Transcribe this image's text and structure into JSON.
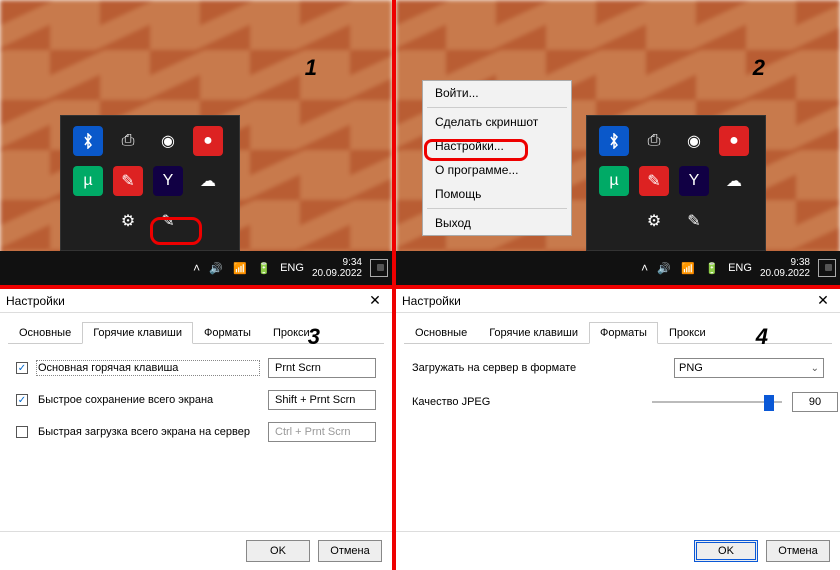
{
  "steps": {
    "s1": "1",
    "s2": "2",
    "s3": "3",
    "s4": "4"
  },
  "taskbar": {
    "lang": "ENG",
    "time1": "9:34",
    "date1": "20.09.2022",
    "time2": "9:38",
    "date2": "20.09.2022"
  },
  "tray_icons": [
    "bluetooth",
    "usb",
    "shield",
    "alert",
    "utorrent",
    "yandex-disk",
    "yandex",
    "cloud",
    "unknown",
    "settings",
    "lightshot"
  ],
  "context_menu": {
    "login": "Войти...",
    "screenshot": "Сделать скриншот",
    "settings": "Настройки...",
    "about": "О программе...",
    "help": "Помощь",
    "exit": "Выход"
  },
  "dialog": {
    "title": "Настройки",
    "tabs": {
      "general": "Основные",
      "hotkeys": "Горячие клавиши",
      "formats": "Форматы",
      "proxy": "Прокси"
    },
    "hotkeys": {
      "main_label": "Основная горячая клавиша",
      "main_value": "Prnt Scrn",
      "save_label": "Быстрое сохранение всего экрана",
      "save_value": "Shift + Prnt Scrn",
      "upload_label": "Быстрая загрузка всего экрана на сервер",
      "upload_value": "Ctrl + Prnt Scrn"
    },
    "formats": {
      "upload_label": "Загружать на сервер в формате",
      "upload_value": "PNG",
      "quality_label": "Качество JPEG",
      "quality_value": "90"
    },
    "ok": "OK",
    "cancel": "Отмена"
  }
}
